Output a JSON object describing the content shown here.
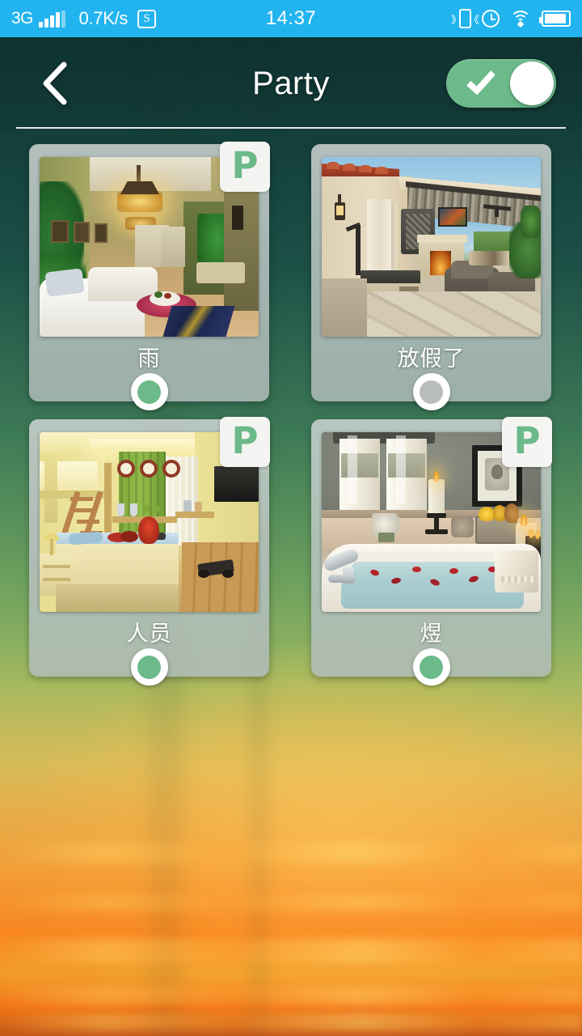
{
  "status_bar": {
    "network_type": "3G",
    "signal_bars_active": 4,
    "signal_bars_total": 5,
    "data_speed": "0.7K/s",
    "data_saver_icon_label": "S",
    "time": "14:37",
    "right_icons": [
      "vibrate-icon",
      "alarm-clock-icon",
      "wifi-icon",
      "battery-icon"
    ],
    "background_color": "#22b4ef",
    "text_color": "#ffffff"
  },
  "header": {
    "back_icon": "chevron-left-icon",
    "title": "Party",
    "master_toggle": {
      "state": "on",
      "icon": "check-icon",
      "on_color": "#6cb98a",
      "knob_color": "#ffffff"
    }
  },
  "theme": {
    "accent_green": "#6cb98a",
    "inactive_gray": "#b9bdbd",
    "card_surface": "#c2cbc8",
    "label_color": "#ffffff",
    "wallpaper_top": "#0e3433",
    "wallpaper_bottom": "#d06a1c"
  },
  "scene_grid": {
    "columns": 2,
    "cards": [
      {
        "label": "雨",
        "badge": "P",
        "badge_visible": true,
        "indicator_state": "on",
        "indicator_color": "#6cb98a",
        "photo_name": "living-room-chandelier-photo"
      },
      {
        "label": "放假了",
        "badge": "P",
        "badge_visible": false,
        "indicator_state": "off",
        "indicator_color": "#b9bdbd",
        "photo_name": "outdoor-patio-lounge-photo"
      },
      {
        "label": "人员",
        "badge": "P",
        "badge_visible": true,
        "indicator_state": "on",
        "indicator_color": "#6cb98a",
        "photo_name": "kids-bunk-bedroom-photo"
      },
      {
        "label": "煜",
        "badge": "P",
        "badge_visible": true,
        "indicator_state": "on",
        "indicator_color": "#6cb98a",
        "photo_name": "bathroom-spa-tub-photo"
      }
    ]
  }
}
